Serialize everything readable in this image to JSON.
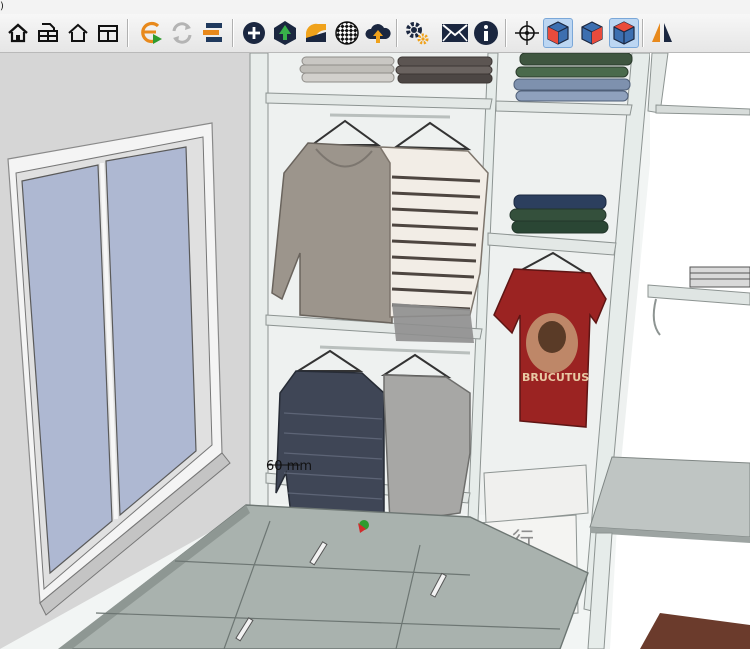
{
  "window": {
    "title_fragment": ")"
  },
  "toolbar": {
    "tools": [
      {
        "id": "home",
        "icon": "house-icon"
      },
      {
        "id": "print",
        "icon": "printer-icon"
      },
      {
        "id": "house-outline",
        "icon": "house-outline-icon"
      },
      {
        "id": "cabinet",
        "icon": "cabinet-icon"
      },
      {
        "id": "render",
        "icon": "render-play-icon"
      },
      {
        "id": "refresh",
        "icon": "refresh-icon"
      },
      {
        "id": "layers",
        "icon": "stacked-layers-icon"
      },
      {
        "id": "add",
        "icon": "plus-circle-icon"
      },
      {
        "id": "tree",
        "icon": "tree-icon"
      },
      {
        "id": "material",
        "icon": "material-swatch-icon"
      },
      {
        "id": "checker",
        "icon": "checker-ball-icon"
      },
      {
        "id": "upload",
        "icon": "cloud-upload-icon"
      },
      {
        "id": "settings",
        "icon": "gears-icon"
      },
      {
        "id": "mail",
        "icon": "mail-icon"
      },
      {
        "id": "info",
        "icon": "info-icon"
      },
      {
        "id": "orbit",
        "icon": "orbit-target-icon"
      },
      {
        "id": "view-front",
        "icon": "cube-front-icon"
      },
      {
        "id": "view-side",
        "icon": "cube-side-icon"
      },
      {
        "id": "view-top",
        "icon": "cube-top-icon"
      },
      {
        "id": "mirror",
        "icon": "mirror-icon"
      }
    ]
  },
  "scene": {
    "dimension_label": "60 mm",
    "box_label": "行",
    "shirt_text": "BRUCUTUS",
    "colors": {
      "wall": "#d8d8d8",
      "cabinet_board": "#e6ecea",
      "cabinet_edge": "#9fa6a4",
      "glass": "#aeb8d2",
      "bed_top": "#a9b2ae",
      "red_shirt": "#9b2322"
    }
  }
}
